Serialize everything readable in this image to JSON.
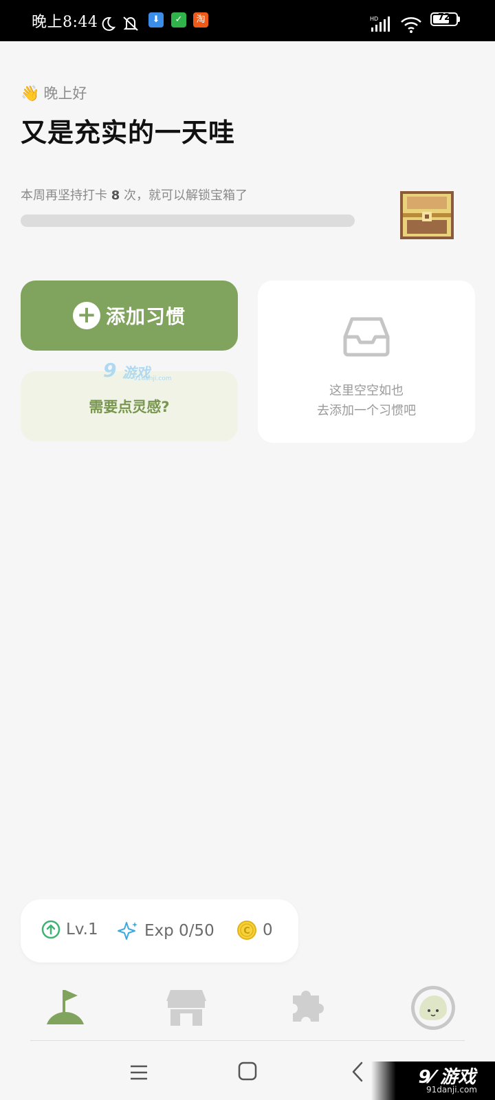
{
  "status_bar": {
    "time": "晚上8:44",
    "battery_level": "72",
    "battery_fraction": 0.72,
    "icons": [
      "moon-icon",
      "mute-bell-icon",
      "download-app-icon",
      "shield-app-icon",
      "taobao-app-icon",
      "hd-signal-icon",
      "wifi-icon",
      "battery-icon"
    ],
    "app_icons": [
      {
        "label": "⬇",
        "color": "#3b8ee8"
      },
      {
        "label": "✓",
        "color": "#2fb34a"
      },
      {
        "label": "淘",
        "color": "#ef5a1b"
      }
    ]
  },
  "header": {
    "wave_emoji": "👋",
    "greeting": "晚上好",
    "title": "又是充实的一天哇"
  },
  "streak": {
    "prefix": "本周再坚持打卡",
    "count": "8",
    "suffix": "次，就可以解锁宝箱了",
    "progress": 0
  },
  "actions": {
    "add_habit_label": "添加习惯",
    "inspiration_label": "需要点灵感?"
  },
  "empty_state": {
    "line1": "这里空空如也",
    "line2": "去添加一个习惯吧"
  },
  "stats": {
    "level": "Lv.1",
    "exp": "Exp 0/50",
    "coins": "0"
  },
  "tabs": [
    "golf-flag-icon",
    "store-icon",
    "puzzle-icon",
    "avatar"
  ],
  "watermarks": {
    "mid_num": "9",
    "mid_text": "游戏",
    "mid_sub": "91danji.com",
    "corner_text": "9⁄ 游戏",
    "corner_sub": "91danji.com"
  },
  "colors": {
    "accent": "#80a35d",
    "background": "#f6f6f6"
  }
}
